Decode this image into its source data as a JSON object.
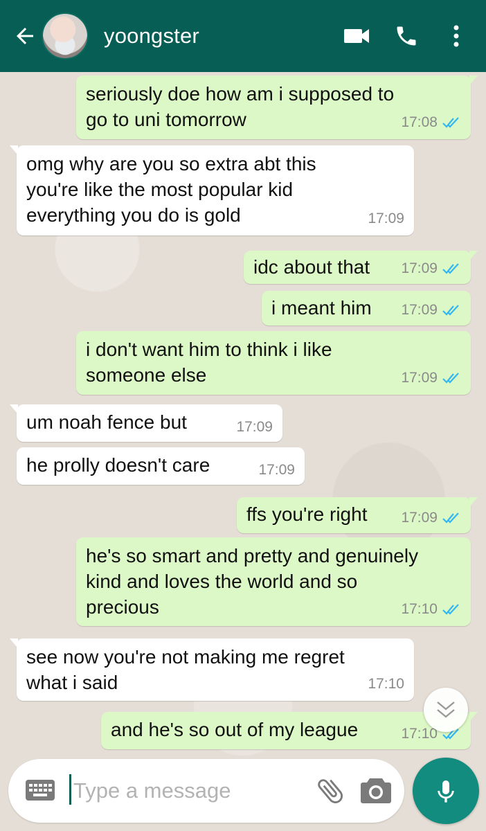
{
  "header": {
    "contact_name": "yoongster",
    "icons": [
      "back-arrow-icon",
      "avatar",
      "video-call-icon",
      "phone-icon",
      "more-vert-icon"
    ]
  },
  "messages": [
    {
      "dir": "out",
      "text": "seriously doe how am i supposed to\ngo to uni tomorrow",
      "time": "17:08",
      "read": true
    },
    {
      "dir": "in",
      "text": "omg why are you so extra abt this\nyou're like the most popular kid\neverything you do is gold",
      "time": "17:09"
    },
    {
      "dir": "out",
      "text": "idc about that",
      "time": "17:09",
      "read": true
    },
    {
      "dir": "out",
      "text": "i meant him",
      "time": "17:09",
      "read": true
    },
    {
      "dir": "out",
      "text": "i don't want him to think i like\nsomeone else",
      "time": "17:09",
      "read": true
    },
    {
      "dir": "in",
      "text": "um noah fence but",
      "time": "17:09"
    },
    {
      "dir": "in",
      "text": "he prolly doesn't care",
      "time": "17:09"
    },
    {
      "dir": "out",
      "text": "ffs you're right",
      "time": "17:09",
      "read": true
    },
    {
      "dir": "out",
      "text": "he's so smart and pretty and genuinely\nkind and loves the world and so\nprecious",
      "time": "17:10",
      "read": true
    },
    {
      "dir": "in",
      "text": "see now you're not making me regret\nwhat i said",
      "time": "17:10"
    },
    {
      "dir": "out",
      "text": "and he's so out of my league",
      "time": "17:10",
      "read": true
    }
  ],
  "composer": {
    "placeholder": "Type a message"
  },
  "colors": {
    "header": "#075e54",
    "outgoing_bubble": "#dcf8c6",
    "incoming_bubble": "#ffffff",
    "read_ticks": "#34b7f1",
    "mic_button": "#128c7e"
  }
}
